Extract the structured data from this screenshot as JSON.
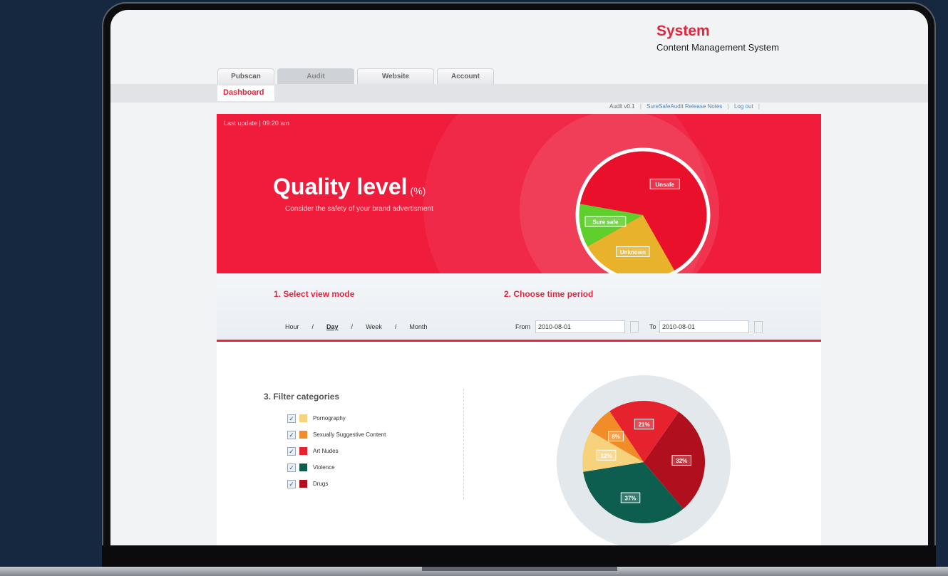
{
  "brand": {
    "title": "System",
    "subtitle": "Content Management System"
  },
  "tabs": [
    {
      "label": "Pubscan"
    },
    {
      "label": "Audit"
    },
    {
      "label": "Website"
    },
    {
      "label": "Account"
    }
  ],
  "subtab": {
    "label": "Dashboard"
  },
  "toplinks": {
    "version": "Audit v0.1",
    "release_notes": "SureSafeAudit Release Notes",
    "logout": "Log out"
  },
  "hero": {
    "last_update": "Last update | 09:20 am",
    "title": "Quality level",
    "unit": "(%)",
    "subtitle": "Consider the safety of your brand advertisment",
    "pie": {
      "unsafe": "Unsafe",
      "sure_safe": "Sure safe",
      "unknown": "Unknown"
    }
  },
  "view_mode": {
    "heading": "1. Select view mode",
    "options": [
      "Hour",
      "Day",
      "Week",
      "Month"
    ],
    "separator": "/",
    "selected": "Day"
  },
  "time_period": {
    "heading": "2. Choose time period",
    "from_label": "From",
    "from_value": "2010-08-01",
    "to_label": "To",
    "to_value": "2010-08-01"
  },
  "categories": {
    "heading": "3. Filter categories",
    "items": [
      {
        "label": "Pornography",
        "color": "#f7d27d"
      },
      {
        "label": "Sexually Suggestive Content",
        "color": "#f28c28"
      },
      {
        "label": "Art Nudes",
        "color": "#e5222e"
      },
      {
        "label": "Violence",
        "color": "#0e5e4f"
      },
      {
        "label": "Drugs",
        "color": "#b0101e"
      }
    ]
  },
  "colors": {
    "accent": "#ef1c3c",
    "unsafe": "#e8102a",
    "unknown": "#e8b22a",
    "sure_safe": "#5fcf2c"
  },
  "chart_data": [
    {
      "type": "pie",
      "title": "",
      "slices": [
        {
          "name": "Unsafe",
          "value": 64,
          "color": "#e8102a"
        },
        {
          "name": "Unknown",
          "value": 25,
          "color": "#e8b22a"
        },
        {
          "name": "Sure safe",
          "value": 11,
          "color": "#5fcf2c"
        }
      ]
    },
    {
      "type": "pie",
      "title": "",
      "slices": [
        {
          "name": "Drugs",
          "value": 32,
          "label": "32%",
          "color": "#b0101e"
        },
        {
          "name": "Violence",
          "value": 37,
          "label": "37%",
          "color": "#0e5e4f"
        },
        {
          "name": "Pornography",
          "value": 12,
          "label": "12%",
          "color": "#f7d27d"
        },
        {
          "name": "Sexually Suggestive Content",
          "value": 8,
          "label": "8%",
          "color": "#f28c28"
        },
        {
          "name": "Art Nudes",
          "value": 21,
          "label": "21%",
          "color": "#e5222e"
        }
      ]
    }
  ]
}
